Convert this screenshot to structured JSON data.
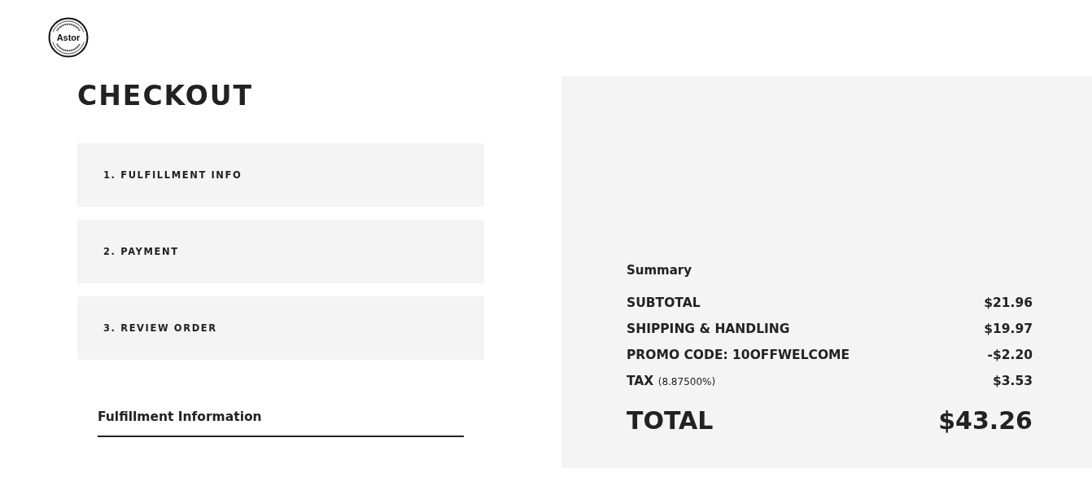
{
  "logo": {
    "name": "Astor"
  },
  "title": "CHECKOUT",
  "steps": [
    {
      "label": "1. FULFILLMENT INFO"
    },
    {
      "label": "2. PAYMENT"
    },
    {
      "label": "3. REVIEW ORDER"
    }
  ],
  "section_heading": "Fulfillment Information",
  "summary": {
    "title": "Summary",
    "rows": [
      {
        "label": "SUBTOTAL",
        "amount": "$21.96"
      },
      {
        "label": "SHIPPING & HANDLING",
        "amount": "$19.97"
      },
      {
        "label": "PROMO CODE: 10OFFWELCOME",
        "amount": "-$2.20"
      },
      {
        "label": "TAX",
        "note": "(8.87500%)",
        "amount": "$3.53"
      }
    ],
    "total": {
      "label": "TOTAL",
      "amount": "$43.26"
    }
  }
}
